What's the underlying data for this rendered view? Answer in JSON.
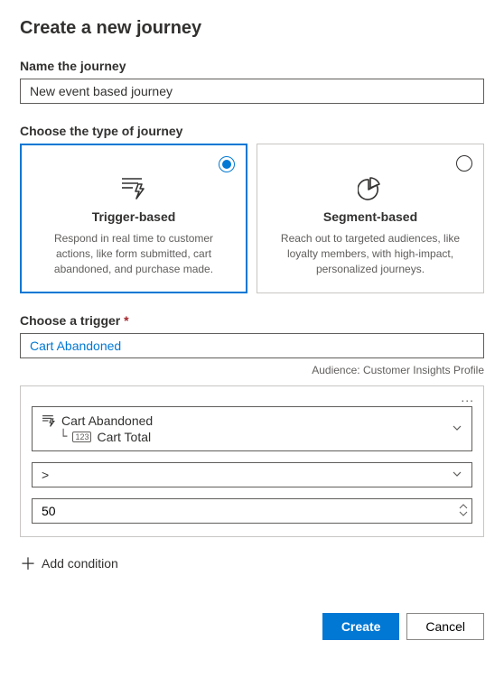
{
  "page_title": "Create a new journey",
  "name_section": {
    "label": "Name the journey",
    "value": "New event based journey"
  },
  "type_section": {
    "label": "Choose the type of journey",
    "cards": {
      "trigger": {
        "title": "Trigger-based",
        "description": "Respond in real time to customer actions, like form submitted, cart abandoned, and purchase made."
      },
      "segment": {
        "title": "Segment-based",
        "description": "Reach out to targeted audiences, like loyalty members, with high-impact, personalized journeys."
      }
    }
  },
  "trigger_section": {
    "label": "Choose a trigger",
    "required_marker": "*",
    "value": "Cart Abandoned",
    "audience_text": "Audience: Customer Insights Profile"
  },
  "condition_panel": {
    "more_label": "...",
    "attribute": {
      "parent": "Cart Abandoned",
      "child": "Cart Total",
      "child_badge": "123"
    },
    "operator": ">",
    "value": "50"
  },
  "add_condition_label": "Add condition",
  "footer": {
    "create": "Create",
    "cancel": "Cancel"
  }
}
